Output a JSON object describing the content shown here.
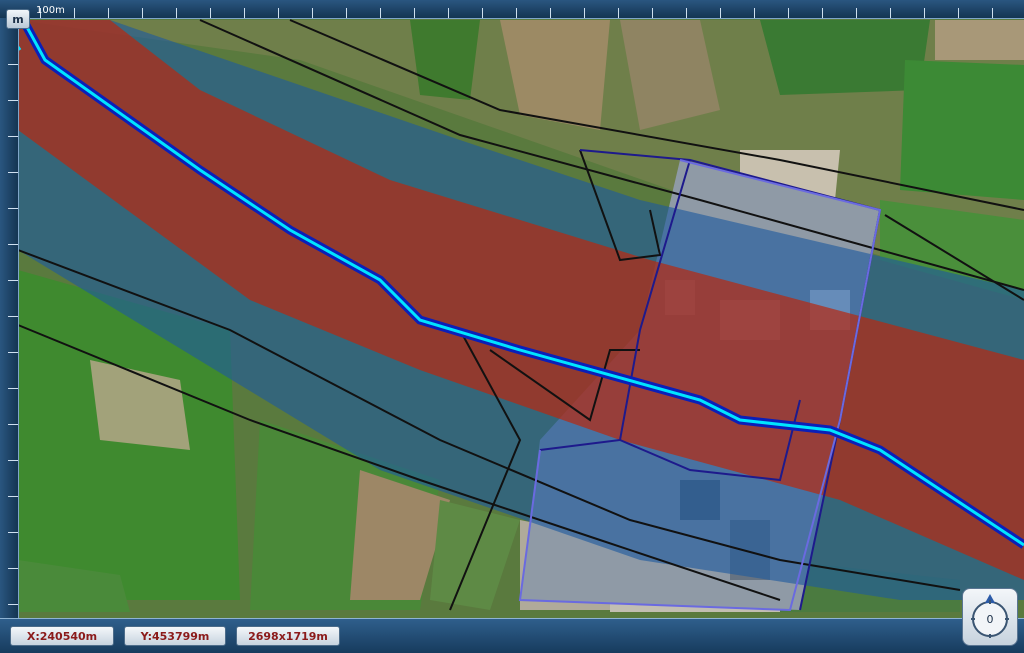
{
  "map": {
    "scale_button_label": "m",
    "scale_text": "100m"
  },
  "status": {
    "x_coord": "X:240540m",
    "y_coord": "Y:453799m",
    "dimensions": "2698x1719m"
  },
  "compass": {
    "heading": "0"
  },
  "colors": {
    "risk_zone_red": "#b52a12",
    "risk_zone_blue": "#1e5b9e",
    "pipeline_cyan": "#00e5ff",
    "pipeline_blue": "#0b1fb8",
    "industrial_outline": "#6a6ae0"
  }
}
